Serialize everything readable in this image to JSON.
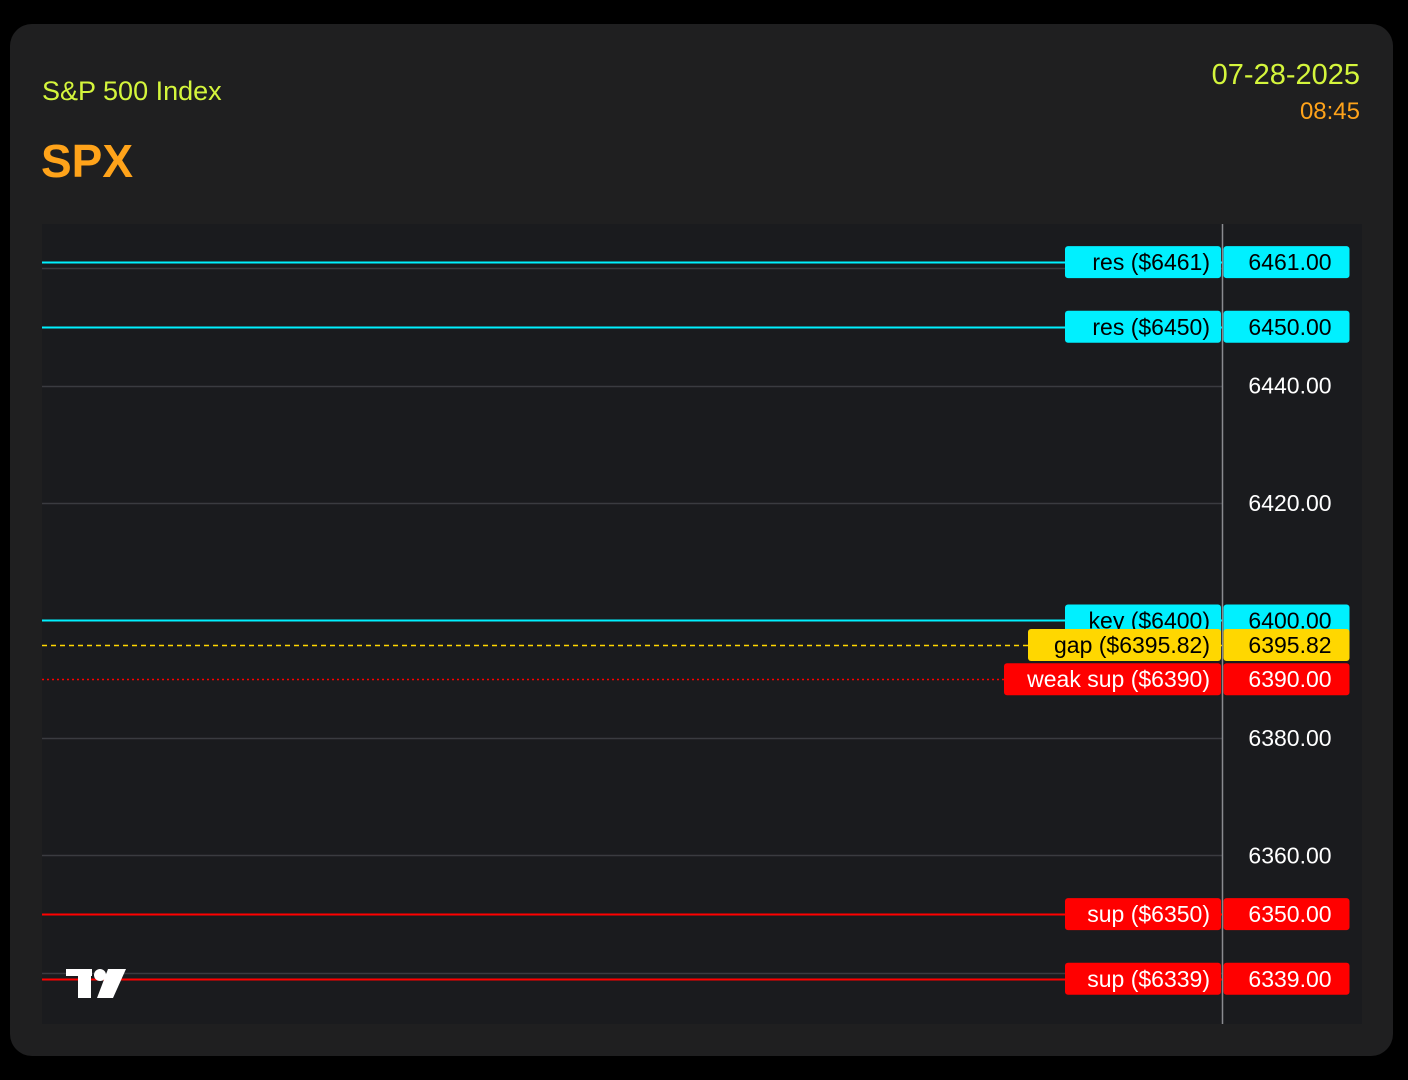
{
  "header": {
    "index_name": "S&P 500 Index",
    "ticker": "SPX",
    "date": "07-28-2025",
    "time": "08:45"
  },
  "colors": {
    "card_background": "#1f1f20",
    "chart_background": "#1a1b1e",
    "grid": "#3a3b40",
    "resistance": "#00f0ff",
    "gap": "#ffd700",
    "support": "#ff0000",
    "axis_text": "#ffffff",
    "index_name": "#d4f53c",
    "ticker": "#ffa31a"
  },
  "chart_data": {
    "type": "line",
    "title": "",
    "xlabel": "",
    "ylabel": "",
    "ylim": [
      6331.3,
      6467.5
    ],
    "grid": true,
    "y_ticks": [
      6440,
      6420,
      6380,
      6360,
      6340,
      6460
    ],
    "y_tick_labels": [
      "6440.00",
      "6420.00",
      "6380.00",
      "6360.00"
    ],
    "levels": [
      {
        "label": "res ($6461)",
        "value": 6461.0,
        "value_label": "6461.00",
        "color": "#00f0ff",
        "style": "solid",
        "text_color": "#000000"
      },
      {
        "label": "res ($6450)",
        "value": 6450.0,
        "value_label": "6450.00",
        "color": "#00f0ff",
        "style": "solid",
        "text_color": "#000000"
      },
      {
        "label": "key ($6400)",
        "value": 6400.0,
        "value_label": "6400.00",
        "color": "#00f0ff",
        "style": "solid",
        "text_color": "#000000"
      },
      {
        "label": "gap ($6395.82)",
        "value": 6395.82,
        "value_label": "6395.82",
        "color": "#ffd700",
        "style": "dashed",
        "text_color": "#000000"
      },
      {
        "label": "weak sup ($6390)",
        "value": 6390.0,
        "value_label": "6390.00",
        "color": "#ff0000",
        "style": "dotted",
        "text_color": "#ffffff"
      },
      {
        "label": "sup ($6350)",
        "value": 6350.0,
        "value_label": "6350.00",
        "color": "#ff0000",
        "style": "solid",
        "text_color": "#ffffff"
      },
      {
        "label": "sup ($6339)",
        "value": 6339.0,
        "value_label": "6339.00",
        "color": "#ff0000",
        "style": "solid",
        "text_color": "#ffffff"
      }
    ]
  },
  "watermark": {
    "icon": "tradingview-logo-icon",
    "text": "TV"
  }
}
